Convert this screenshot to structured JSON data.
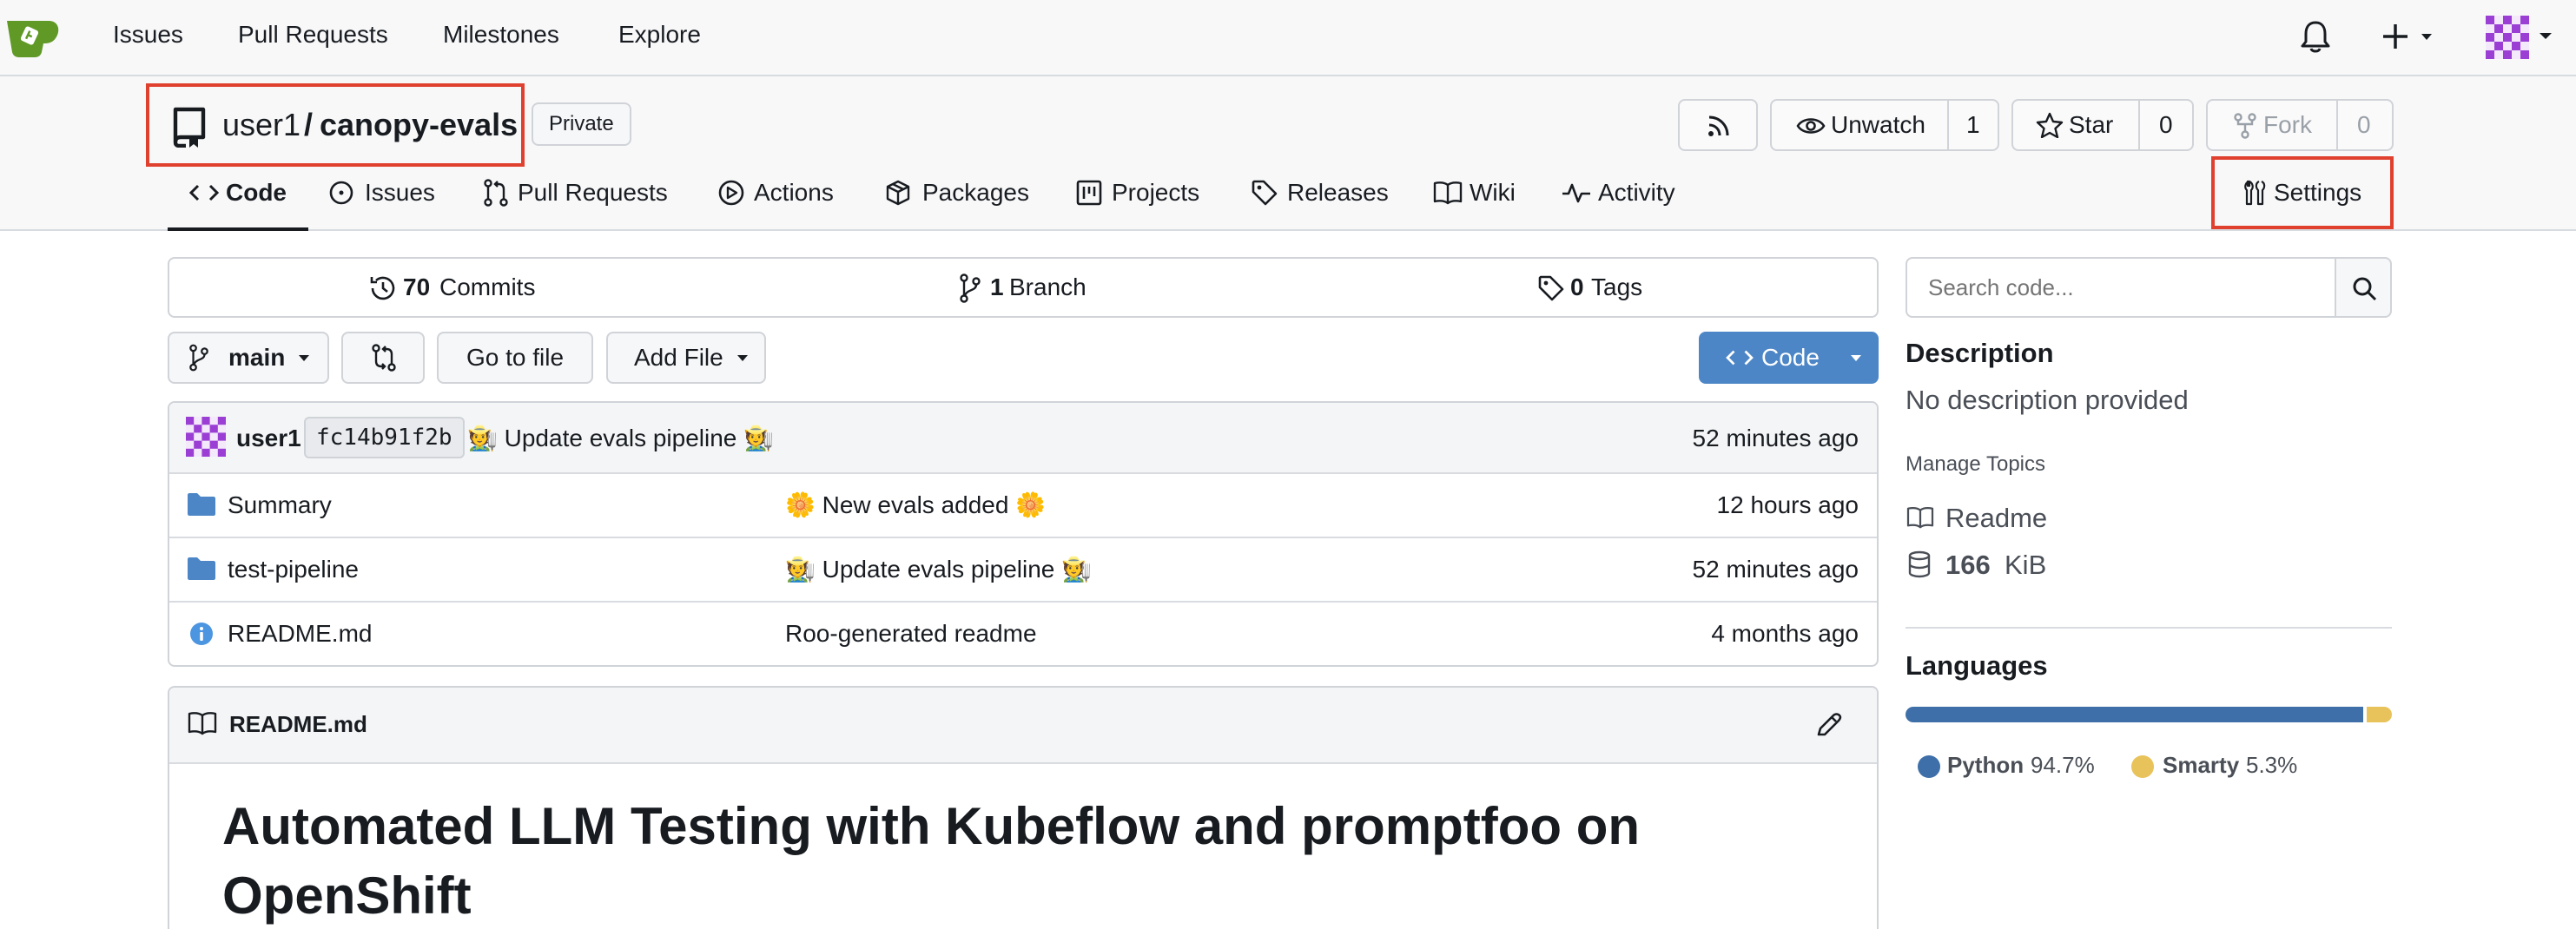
{
  "nav": {
    "items": [
      "Issues",
      "Pull Requests",
      "Milestones",
      "Explore"
    ]
  },
  "repo": {
    "owner": "user1",
    "separator": "/",
    "name": "canopy-evals",
    "visibility": "Private",
    "unwatch_label": "Unwatch",
    "watch_count": "1",
    "star_label": "Star",
    "star_count": "0",
    "fork_label": "Fork",
    "fork_count": "0"
  },
  "tabs": [
    {
      "label": "Code",
      "icon": "code-icon",
      "active": true
    },
    {
      "label": "Issues",
      "icon": "issue-icon"
    },
    {
      "label": "Pull Requests",
      "icon": "pull-request-icon"
    },
    {
      "label": "Actions",
      "icon": "play-icon"
    },
    {
      "label": "Packages",
      "icon": "package-icon"
    },
    {
      "label": "Projects",
      "icon": "project-icon"
    },
    {
      "label": "Releases",
      "icon": "tag-icon"
    },
    {
      "label": "Wiki",
      "icon": "book-icon"
    },
    {
      "label": "Activity",
      "icon": "pulse-icon"
    }
  ],
  "settings_label": "Settings",
  "stats": {
    "commits_count": "70",
    "commits_label": "Commits",
    "branches_count": "1",
    "branches_label": "Branch",
    "tags_count": "0",
    "tags_label": "Tags"
  },
  "toolbar": {
    "branch": "main",
    "goto_file": "Go to file",
    "add_file": "Add File",
    "code": "Code"
  },
  "latest_commit": {
    "author": "user1",
    "sha": "fc14b91f2b",
    "message": "🧑‍🌾 Update evals pipeline 🧑‍🌾",
    "time": "52 minutes ago"
  },
  "files": [
    {
      "name": "Summary",
      "type": "folder",
      "message": "🌼 New evals added 🌼",
      "time": "12 hours ago"
    },
    {
      "name": "test-pipeline",
      "type": "folder",
      "message": "🧑‍🌾 Update evals pipeline 🧑‍🌾",
      "time": "52 minutes ago"
    },
    {
      "name": "README.md",
      "type": "info",
      "message": "Roo-generated readme",
      "time": "4 months ago"
    }
  ],
  "readme": {
    "filename": "README.md",
    "heading_line1": "Automated LLM Testing with Kubeflow and promptfoo on",
    "heading_line2": "OpenShift"
  },
  "sidebar": {
    "search_placeholder": "Search code...",
    "description_title": "Description",
    "description_text": "No description provided",
    "manage_topics": "Manage Topics",
    "readme_link": "Readme",
    "size_value": "166",
    "size_unit": "KiB",
    "languages_title": "Languages",
    "languages": [
      {
        "name": "Python",
        "percent": "94.7%",
        "fraction": 0.947,
        "color": "#3e6fa8"
      },
      {
        "name": "Smarty",
        "percent": "5.3%",
        "fraction": 0.053,
        "color": "#e8c25a"
      }
    ]
  }
}
